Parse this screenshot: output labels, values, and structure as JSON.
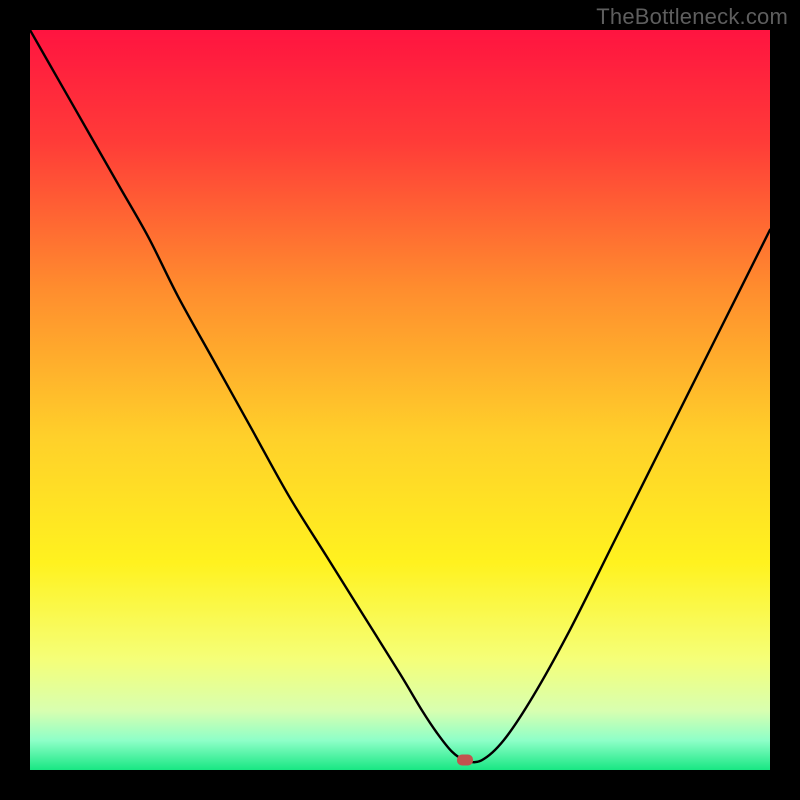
{
  "watermark": {
    "text": "TheBottleneck.com"
  },
  "chart_data": {
    "type": "line",
    "title": "",
    "xlabel": "",
    "ylabel": "",
    "xlim": [
      0,
      100
    ],
    "ylim": [
      0,
      100
    ],
    "grid": false,
    "legend": false,
    "background_gradient": {
      "stops": [
        {
          "pct": 0,
          "color": "#ff1440"
        },
        {
          "pct": 15,
          "color": "#ff3b38"
        },
        {
          "pct": 35,
          "color": "#ff8d2e"
        },
        {
          "pct": 55,
          "color": "#ffd02a"
        },
        {
          "pct": 72,
          "color": "#fff21f"
        },
        {
          "pct": 85,
          "color": "#f5ff78"
        },
        {
          "pct": 92,
          "color": "#d8ffb0"
        },
        {
          "pct": 96,
          "color": "#8effc8"
        },
        {
          "pct": 100,
          "color": "#18e783"
        }
      ]
    },
    "series": [
      {
        "name": "bottleneck-curve",
        "color": "#000000",
        "x": [
          0,
          4,
          8,
          12,
          16,
          20,
          25,
          30,
          35,
          40,
          45,
          50,
          53,
          55,
          57,
          58.8,
          61,
          64,
          68,
          73,
          79,
          86,
          93,
          100
        ],
        "y": [
          100,
          93,
          86,
          79,
          72,
          64,
          55,
          46,
          37,
          29,
          21,
          13,
          8,
          5,
          2.5,
          1.3,
          1.3,
          4,
          10,
          19,
          31,
          45,
          59,
          73
        ]
      }
    ],
    "marker": {
      "name": "selected-point",
      "x": 58.8,
      "y": 1.3,
      "color": "#c2544e"
    }
  }
}
